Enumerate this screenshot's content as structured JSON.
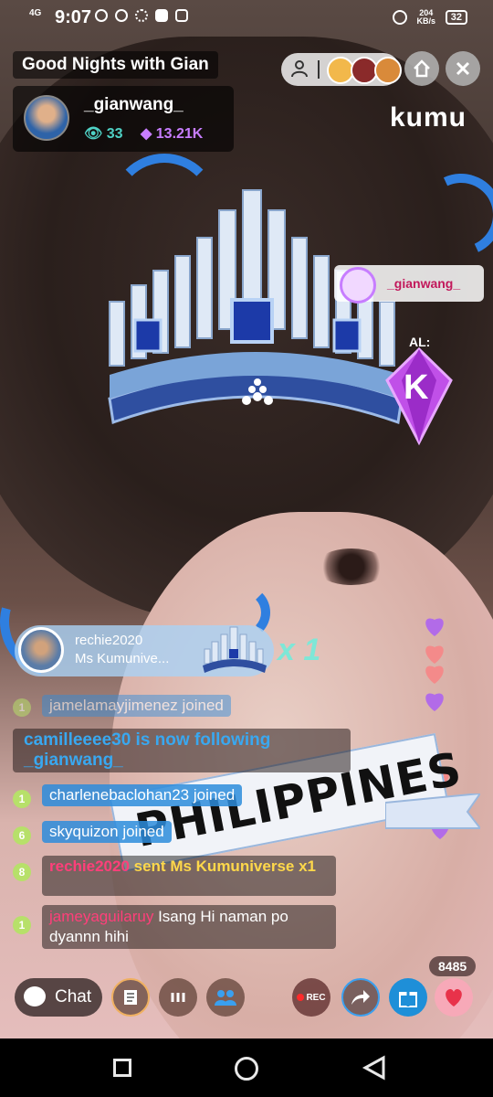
{
  "status_bar": {
    "network": "4G",
    "time": "9:07",
    "speed": "204 KB/s",
    "battery": "32"
  },
  "stream": {
    "title": "Good Nights with Gian",
    "brand": "kumu"
  },
  "host": {
    "name": "_gianwang_",
    "viewers": "33",
    "diamonds": "13.21K"
  },
  "gift_animation": {
    "recipient": "_gianwang_",
    "total_label": "AL:",
    "total_value": "K"
  },
  "gift_notice": {
    "user": "rechie2020",
    "gift": "Ms Kumunive...",
    "multiplier": "x 1"
  },
  "chat": [
    {
      "type": "join",
      "level": "1",
      "text": "jamelamayjimenez joined"
    },
    {
      "type": "follow",
      "text": "camilleeee30 is now following _gianwang_"
    },
    {
      "type": "join",
      "level": "1",
      "text": "charlenebaclohan23 joined"
    },
    {
      "type": "join",
      "level": "6",
      "text": "skyquizon joined"
    },
    {
      "type": "gift",
      "level": "8",
      "user": "rechie2020",
      "text": "sent Ms Kumuniverse x1"
    },
    {
      "type": "message",
      "level": "1",
      "user": "jameyaguilaruy",
      "text": "Isang Hi naman po dyannn hihi"
    }
  ],
  "overlay_banner": "PHILIPPINES",
  "likes_count": "8485",
  "bottom_bar": {
    "chat_label": "Chat",
    "rec_label": "REC"
  },
  "colors": {
    "accent_blue": "#2f7fe0",
    "kumu_teal": "#4fd1c5",
    "diamond_purple": "#c77dff"
  }
}
